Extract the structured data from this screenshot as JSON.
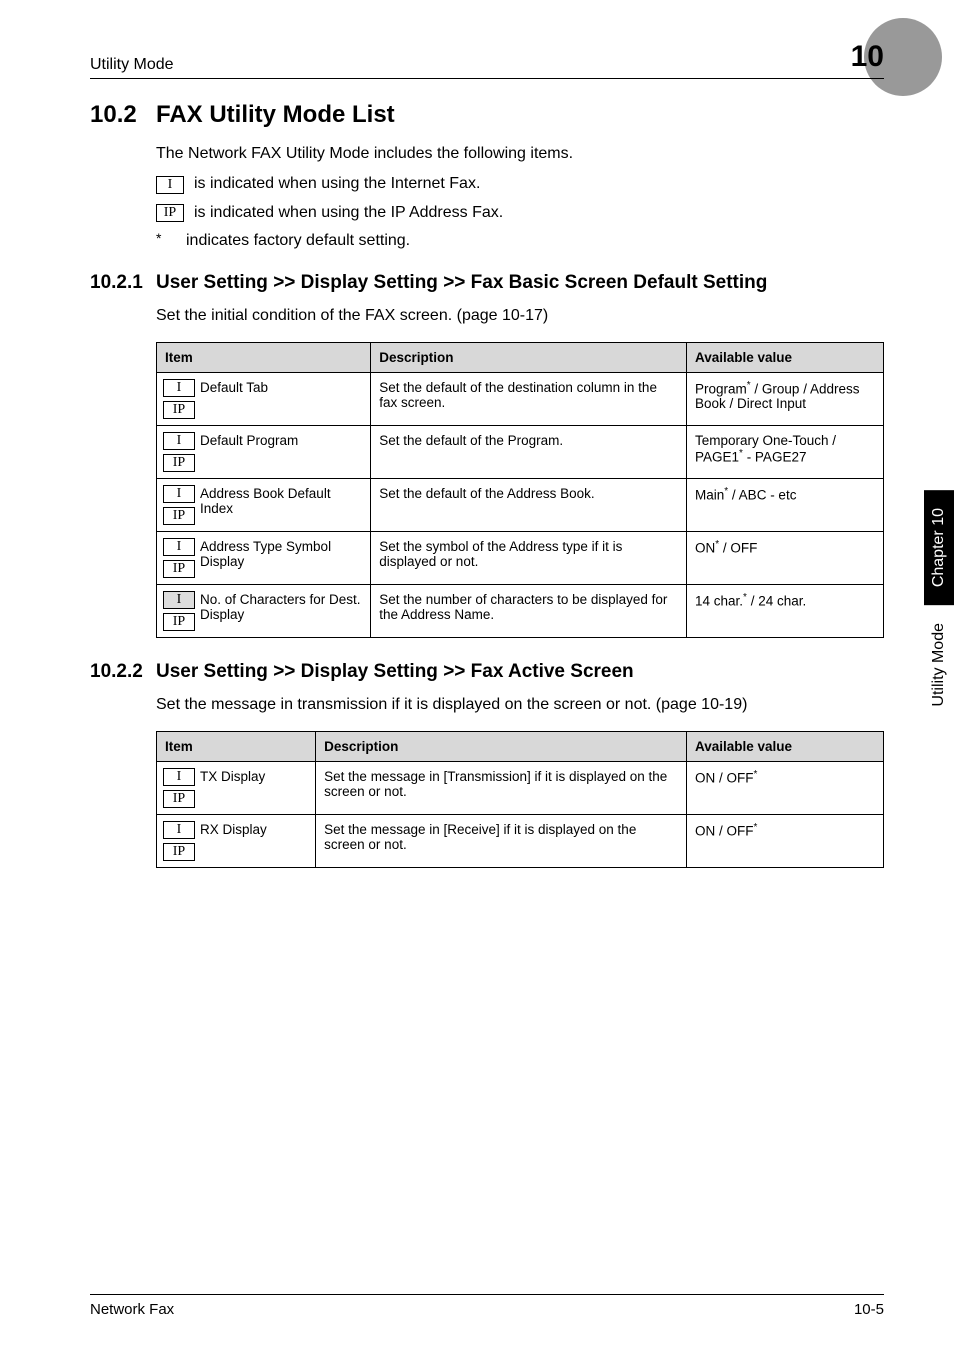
{
  "header": {
    "left": "Utility Mode",
    "chapter_number": "10"
  },
  "section": {
    "number": "10.2",
    "title": "FAX Utility Mode List",
    "intro": "The Network FAX Utility Mode includes the following items.",
    "indicator_i": "is indicated when using the Internet Fax.",
    "indicator_ip": "is indicated when using the IP Address Fax.",
    "star_label": "*",
    "star_text": "indicates factory default setting."
  },
  "icons": {
    "i": "I",
    "ip": "IP"
  },
  "sub1": {
    "number": "10.2.1",
    "title": "User Setting >> Display Setting >> Fax Basic Screen Default Setting",
    "text": "Set the initial condition of the FAX screen. (page 10-17)"
  },
  "table_headers": {
    "item": "Item",
    "desc": "Description",
    "avail": "Available value"
  },
  "table1": [
    {
      "item": "Default Tab",
      "desc": "Set the default of the destination column in the fax screen.",
      "avail": "Program* / Group / Address Book / Direct Input"
    },
    {
      "item": "Default Program",
      "desc": "Set the default of the Program.",
      "avail": "Temporary One-Touch / PAGE1* - PAGE27"
    },
    {
      "item": "Address Book Default Index",
      "desc": "Set the default of the Address Book.",
      "avail": "Main* / ABC - etc"
    },
    {
      "item": "Address Type Symbol Display",
      "desc": "Set the symbol of the Address type if it is displayed or not.",
      "avail": "ON* / OFF"
    },
    {
      "item": "No. of Characters for Dest. Display",
      "desc": "Set the number of characters to be displayed for the Address Name.",
      "avail": "14 char.* / 24 char.",
      "dim": true
    }
  ],
  "sub2": {
    "number": "10.2.2",
    "title": "User Setting >> Display Setting >> Fax Active Screen",
    "text": "Set the message in transmission if it is displayed on the screen or not. (page 10-19)"
  },
  "table2": [
    {
      "item": "TX Display",
      "desc": "Set the message in [Transmission] if it is displayed on the screen or not.",
      "avail": "ON / OFF*"
    },
    {
      "item": "RX Display",
      "desc": "Set the message in [Receive] if it is displayed on the screen or not.",
      "avail": "ON / OFF*"
    }
  ],
  "side": {
    "black": "Chapter 10",
    "white": "Utility Mode"
  },
  "footer": {
    "left": "Network Fax",
    "right": "10-5"
  }
}
